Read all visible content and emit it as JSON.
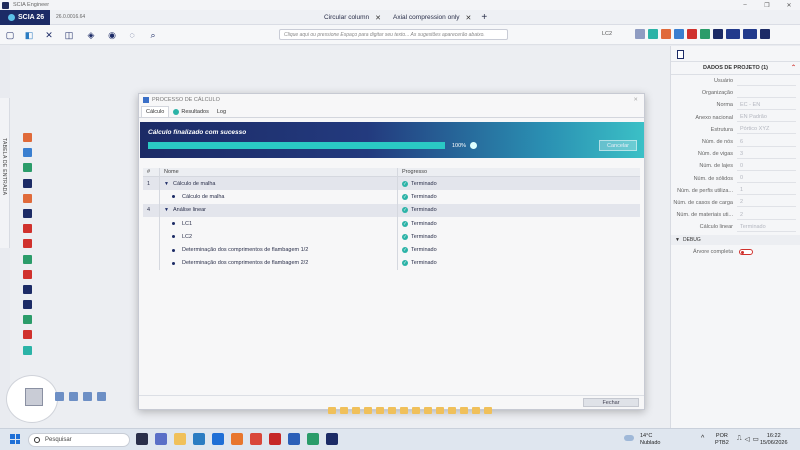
{
  "window": {
    "app_title": "SCIA Engineer",
    "product_tab": "SCIA 26",
    "version": "26.0.0016.64",
    "doc_tabs": [
      {
        "label": "Circular column"
      },
      {
        "label": "Axial compression only"
      }
    ],
    "command_placeholder": "Clique aqui ou pressione Espaço para digitar seu texto... As sugestões aparecerão abaixo.",
    "load_case_selector": "LC2",
    "left_panel_label": "TABELA DE ENTRADA"
  },
  "dialog": {
    "title": "PROCESSO DE CÁLCULO",
    "tabs": [
      {
        "label": "Cálculo",
        "active": true
      },
      {
        "label": "Resultados",
        "active": false
      },
      {
        "label": "Log",
        "active": false
      }
    ],
    "banner_title": "Cálculo finalizado com sucesso",
    "progress_value": 100,
    "progress_text": "100%",
    "cancel_label": "Cancelar",
    "columns": {
      "num": "#",
      "name": "Nome",
      "progress": "Progresso"
    },
    "rows": [
      {
        "num": "1",
        "name": "Cálculo de malha",
        "status": "Terminado",
        "level": 0
      },
      {
        "num": "",
        "name": "Cálculo de malha",
        "status": "Terminado",
        "level": 1
      },
      {
        "num": "4",
        "name": "Análise linear",
        "status": "Terminado",
        "level": 0
      },
      {
        "num": "",
        "name": "LC1",
        "status": "Terminado",
        "level": 1
      },
      {
        "num": "",
        "name": "LC2",
        "status": "Terminado",
        "level": 1
      },
      {
        "num": "",
        "name": "Determinação dos comprimentos de flambagem 1/2",
        "status": "Terminado",
        "level": 1
      },
      {
        "num": "",
        "name": "Determinação dos comprimentos de flambagem 2/2",
        "status": "Terminado",
        "level": 1
      }
    ],
    "close_label": "Fechar"
  },
  "project_panel": {
    "title": "DADOS DE PROJETO (1)",
    "properties": [
      {
        "key": "Usuário",
        "value": ""
      },
      {
        "key": "Organização",
        "value": ""
      },
      {
        "key": "Norma",
        "value": "EC - EN"
      },
      {
        "key": "Anexo nacional",
        "value": "EN Padrão"
      },
      {
        "key": "Estrutura",
        "value": "Pórtico XYZ"
      },
      {
        "key": "Núm. de nós",
        "value": "6"
      },
      {
        "key": "Núm. de vigas",
        "value": "3"
      },
      {
        "key": "Núm. de lajes",
        "value": "0"
      },
      {
        "key": "Núm. de sólidos",
        "value": "0"
      },
      {
        "key": "Núm. de perfis utiliza...",
        "value": "1"
      },
      {
        "key": "Núm. de casos de carga",
        "value": "2"
      },
      {
        "key": "Núm. de materiais uti...",
        "value": "2"
      },
      {
        "key": "Cálculo linear",
        "value": "Terminado"
      }
    ],
    "debug_section": "DEBUG",
    "debug_item": "Árvore completa"
  },
  "taskbar": {
    "search_placeholder": "Pesquisar",
    "temperature": "14°C",
    "weather": "Nublado",
    "lang_line1": "POR",
    "lang_line2": "PTB2",
    "time": "16:22",
    "date": "15/06/2026"
  },
  "colors": {
    "brand_navy": "#1c2b66",
    "accent_teal": "#2bb3a7",
    "toggle_red": "#d0312d"
  }
}
